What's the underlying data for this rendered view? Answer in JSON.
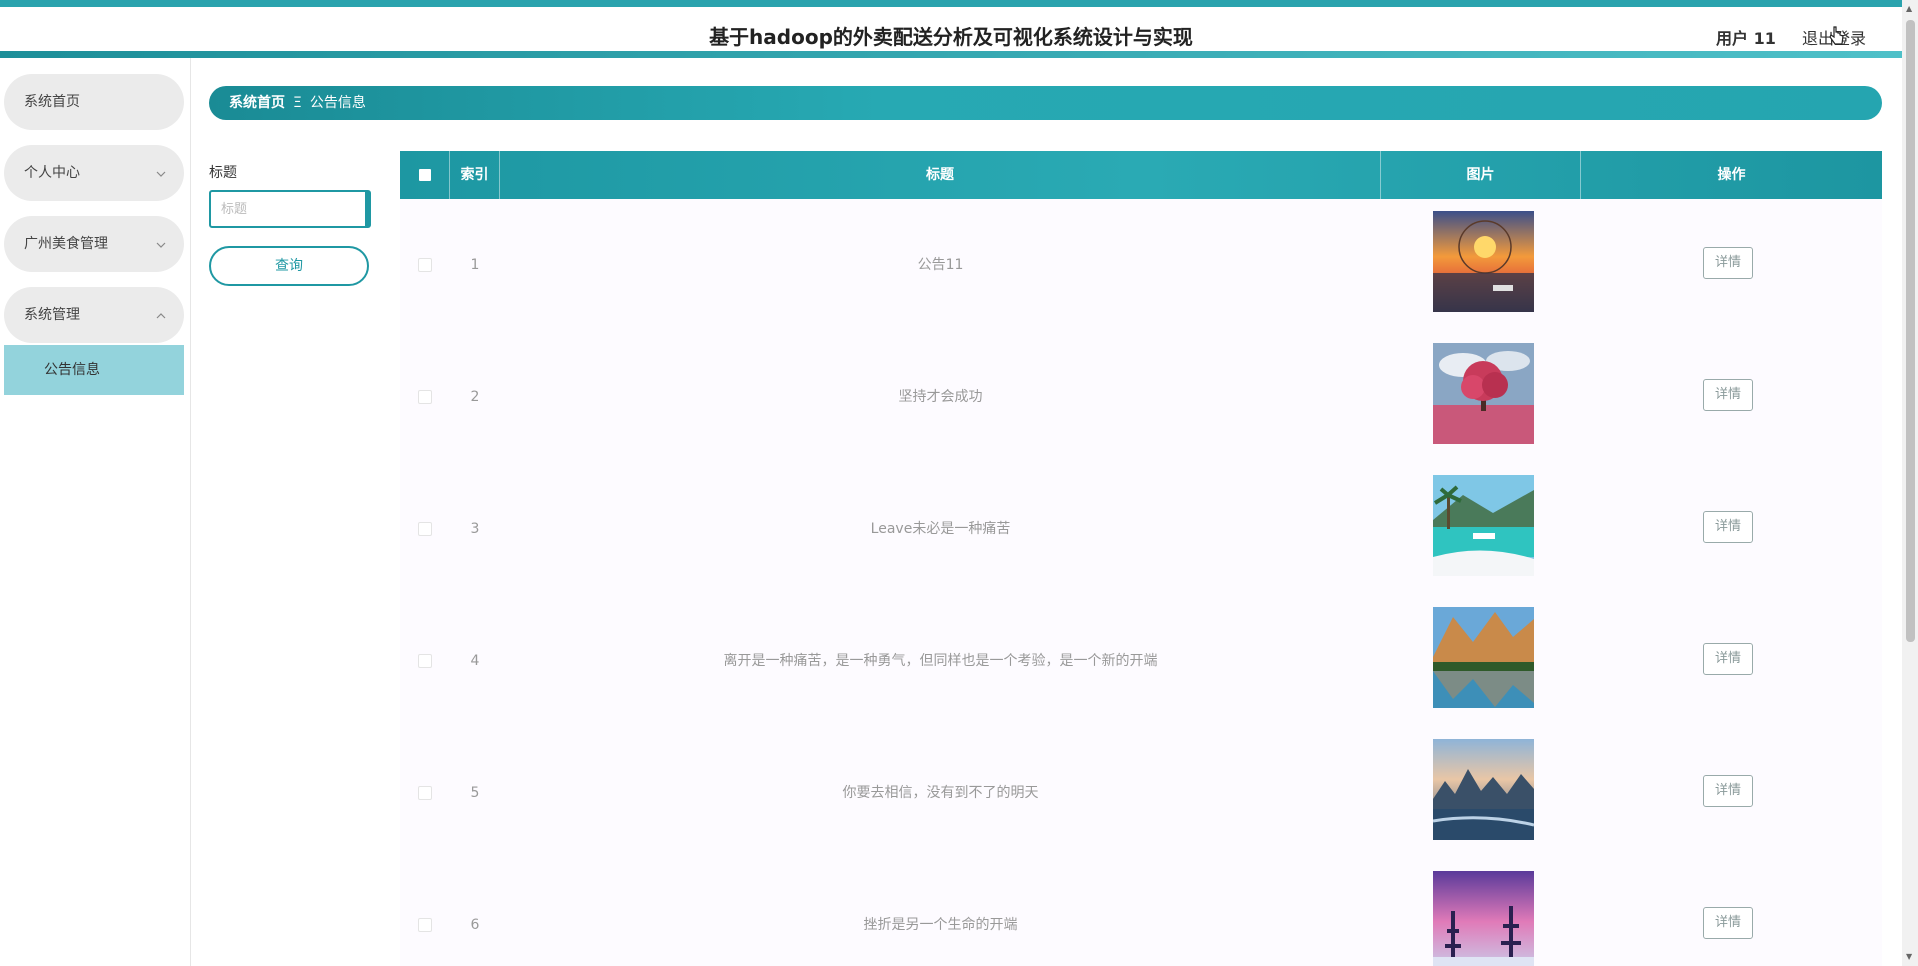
{
  "header": {
    "title": "基于hadoop的外卖配送分析及可视化系统设计与实现",
    "user": "用户 11",
    "logout": "退出登录"
  },
  "sidebar": {
    "items": [
      {
        "label": "系统首页"
      },
      {
        "label": "个人中心",
        "chevron": "⌵"
      },
      {
        "label": "广州美食管理",
        "chevron": "⌵"
      },
      {
        "label": "系统管理",
        "chevron": "⌃"
      }
    ],
    "subitem": "公告信息"
  },
  "breadcrumb": {
    "home": "系统首页",
    "separator": "Ξ",
    "current": "公告信息"
  },
  "search": {
    "label": "标题",
    "placeholder": "标题",
    "button": "查询"
  },
  "table": {
    "headers": {
      "index": "索引",
      "title": "标题",
      "image": "图片",
      "action": "操作"
    },
    "rows": [
      {
        "index": "1",
        "title": "公告11",
        "image": "sunset-ferris-wheel",
        "action": "详情"
      },
      {
        "index": "2",
        "title": "坚持才会成功",
        "image": "pink-tree-field",
        "action": "详情"
      },
      {
        "index": "3",
        "title": "Leave未必是一种痛苦",
        "image": "tropical-beach",
        "action": "详情"
      },
      {
        "index": "4",
        "title": "离开是一种痛苦，是一种勇气，但同样也是一个考验，是一个新的开端",
        "image": "mountain-lake",
        "action": "详情"
      },
      {
        "index": "5",
        "title": "你要去相信，没有到不了的明天",
        "image": "mountain-river-dusk",
        "action": "详情"
      },
      {
        "index": "6",
        "title": "挫折是另一个生命的开端",
        "image": "snowy-forest-aurora",
        "action": "详情"
      }
    ]
  },
  "colors": {
    "accent": "#1f98a3",
    "submenu_active": "#93d3dc"
  }
}
